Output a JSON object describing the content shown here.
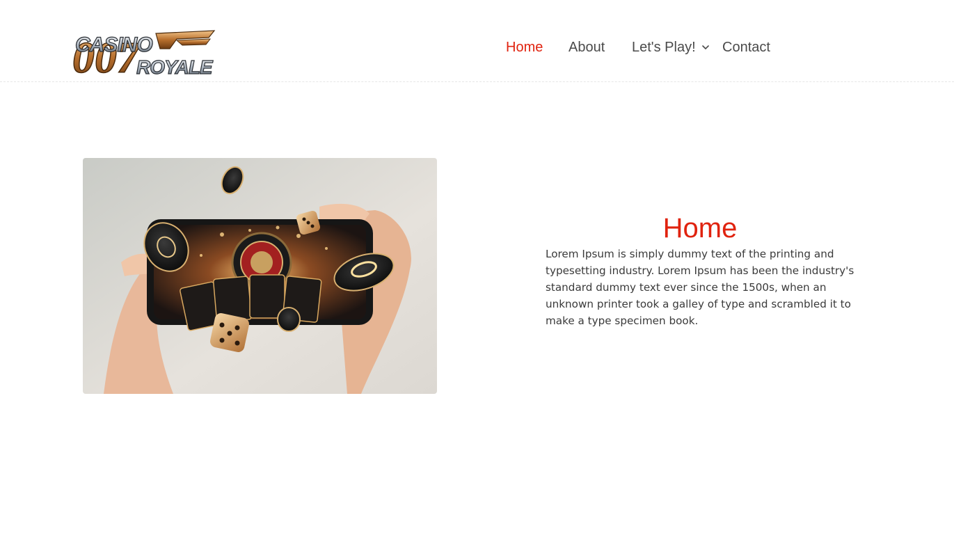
{
  "header": {
    "logo_text_top": "CASINO",
    "logo_text_bottom": "ROYALE",
    "logo_number": "007"
  },
  "nav": {
    "items": [
      {
        "label": "Home",
        "active": true
      },
      {
        "label": "About",
        "active": false
      },
      {
        "label": "Let's Play!",
        "active": false,
        "has_dropdown": true
      },
      {
        "label": "Contact",
        "active": false
      }
    ]
  },
  "main": {
    "title": "Home",
    "body": "Lorem Ipsum is simply dummy text of the printing and typesetting industry. Lorem Ipsum has been the industry's standard dummy text ever since the 1500s, when an unknown printer took a galley of type and scrambled it to make a type specimen book."
  },
  "colors": {
    "accent": "#e0230f",
    "nav_text": "#4a4a4a",
    "body_text": "#3a3a3a"
  }
}
